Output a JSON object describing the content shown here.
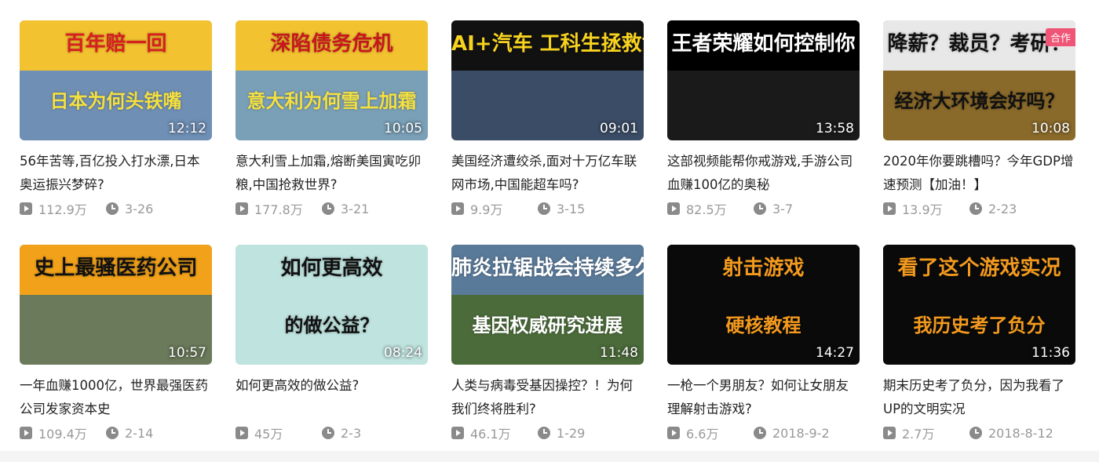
{
  "videos": [
    {
      "thumb_line1": "百年赔一回",
      "thumb_line2": "日本为何头铁嘴",
      "duration": "12:12",
      "title": "56年苦等,百亿投入打水漂,日本奥运振兴梦碎?",
      "views": "112.9万",
      "date": "3-26",
      "colors": {
        "bg": "#6f8fb5",
        "band": "#f2c230",
        "t1": "#d81e1e",
        "t2": "#f4e040"
      }
    },
    {
      "thumb_line1": "深陷债务危机",
      "thumb_line2": "意大利为何雪上加霜",
      "duration": "10:05",
      "title": "意大利雪上加霜,熔断美国寅吃卯粮,中国抢救世界?",
      "views": "177.8万",
      "date": "3-21",
      "colors": {
        "bg": "#7aa0b8",
        "band": "#f2c230",
        "t1": "#c8161d",
        "t2": "#f4e040"
      }
    },
    {
      "thumb_line1": "AI+汽车 工科生拯救世界",
      "thumb_line2": "",
      "duration": "09:01",
      "title": "美国经济遭绞杀,面对十万亿车联网市场,中国能超车吗?",
      "views": "9.9万",
      "date": "3-15",
      "colors": {
        "bg": "#3b4c66",
        "band": "#111111",
        "t1": "#f7d21f",
        "t2": "#ffffff"
      }
    },
    {
      "thumb_line1": "王者荣耀如何控制你",
      "thumb_line2": "",
      "duration": "13:58",
      "title": "这部视频能帮你戒游戏,手游公司血赚100亿的奥秘",
      "views": "82.5万",
      "date": "3-7",
      "colors": {
        "bg": "#1a1a1a",
        "band": "#000000",
        "t1": "#ffffff",
        "t2": "#ffffff"
      }
    },
    {
      "thumb_line1": "降薪？裁员？考研？",
      "thumb_line2": "经济大环境会好吗？",
      "duration": "10:08",
      "collab": "合作",
      "title": "2020年你要跳槽吗？今年GDP增速预测【加油！】",
      "views": "13.9万",
      "date": "2-23",
      "colors": {
        "bg": "#8a6a2a",
        "band": "#e8e8e8",
        "t1": "#111111",
        "t2": "#111111"
      }
    },
    {
      "thumb_line1": "史上最骚医药公司",
      "thumb_line2": "",
      "duration": "10:57",
      "title": "一年血赚1000亿，世界最强医药公司发家资本史",
      "views": "109.4万",
      "date": "2-14",
      "colors": {
        "bg": "#6b7a5a",
        "band": "#f2a21a",
        "t1": "#111111",
        "t2": "#ffffff"
      }
    },
    {
      "thumb_line1": "如何更高效",
      "thumb_line2": "的做公益？",
      "duration": "08:24",
      "title": "如何更高效的做公益?",
      "views": "45万",
      "date": "2-3",
      "colors": {
        "bg": "#bfe3df",
        "band": "#bfe3df",
        "t1": "#111111",
        "t2": "#111111"
      }
    },
    {
      "thumb_line1": "肺炎拉锯战会持续多久?",
      "thumb_line2": "基因权威研究进展",
      "duration": "11:48",
      "title": "人类与病毒受基因操控？！为何我们终将胜利?",
      "views": "46.1万",
      "date": "1-29",
      "colors": {
        "bg": "#4b6b3a",
        "band": "#5a7a9a",
        "t1": "#ffffff",
        "t2": "#ffffff"
      }
    },
    {
      "thumb_line1": "射击游戏",
      "thumb_line2": "硬核教程",
      "duration": "14:27",
      "title": "一枪一个男朋友？如何让女朋友理解射击游戏?",
      "views": "6.6万",
      "date": "2018-9-2",
      "colors": {
        "bg": "#0a0a0a",
        "band": "#0a0a0a",
        "t1": "#f39a1e",
        "t2": "#f39a1e"
      }
    },
    {
      "thumb_line1": "看了这个游戏实况",
      "thumb_line2": "我历史考了负分",
      "duration": "11:36",
      "title": "期末历史考了负分，因为我看了UP的文明实况",
      "views": "2.7万",
      "date": "2018-8-12",
      "colors": {
        "bg": "#0a0a0a",
        "band": "#0a0a0a",
        "t1": "#f39a1e",
        "t2": "#f39a1e"
      }
    }
  ]
}
